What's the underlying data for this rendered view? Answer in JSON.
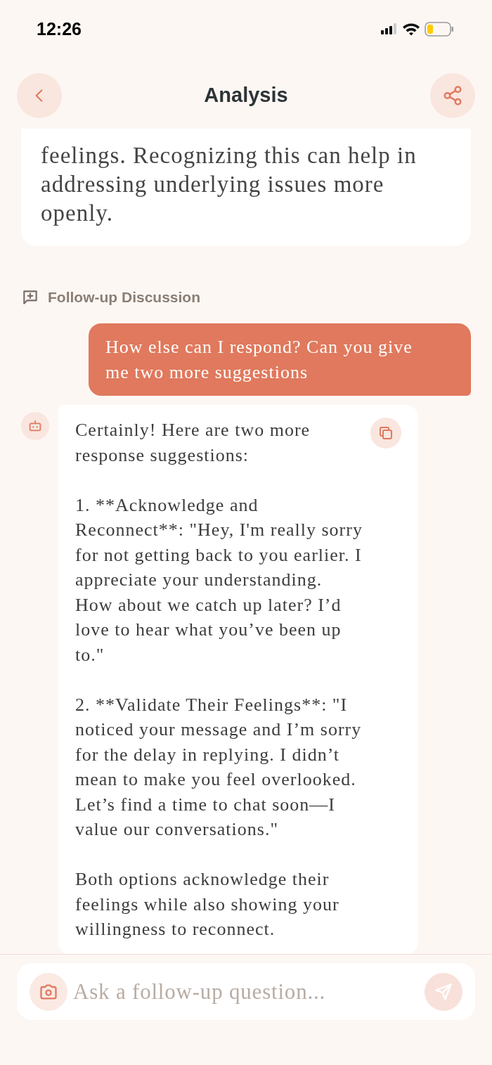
{
  "status_bar": {
    "time": "12:26"
  },
  "header": {
    "title": "Analysis"
  },
  "analysis_card": {
    "text": "feelings. Recognizing this can help in addressing underlying issues more openly."
  },
  "section": {
    "title": "Follow-up Discussion"
  },
  "messages": [
    {
      "kind": "user",
      "paragraphs": [
        "How else can I respond? Can you give me two more suggestions"
      ]
    },
    {
      "kind": "bot",
      "paragraphs": [
        "Certainly! Here are two more response suggestions:",
        "1. **Acknowledge and Reconnect**: \"Hey, I'm really sorry for not getting back to you earlier. I appreciate your understanding. How about we catch up later? I’d love to hear what you’ve been up to.\"",
        "2. **Validate Their Feelings**: \"I noticed your message and I’m sorry for the delay in replying. I didn’t mean to make you feel overlooked. Let’s find a time to chat soon—I value our conversations.\"",
        "Both options acknowledge their feelings while also showing your willingness to reconnect."
      ]
    }
  ],
  "composer": {
    "placeholder": "Ask a follow-up question...",
    "send_enabled": false
  }
}
